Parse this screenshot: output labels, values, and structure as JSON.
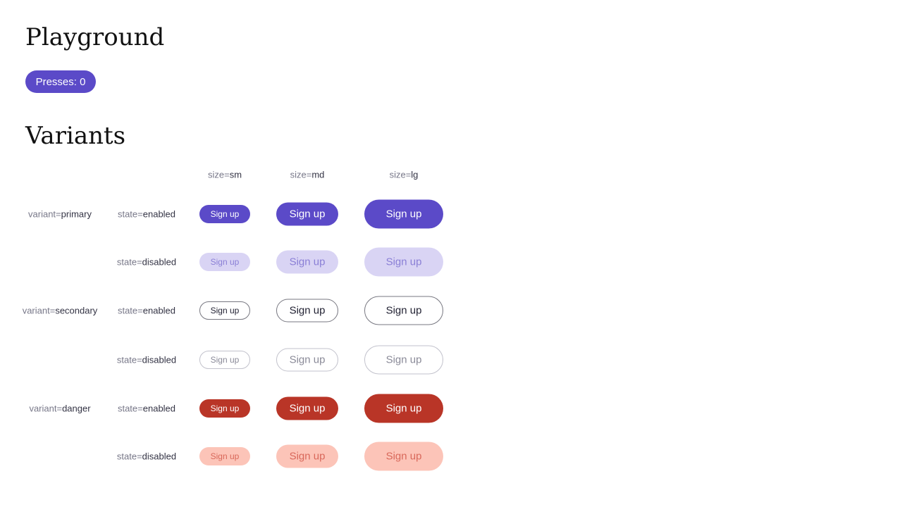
{
  "playground": {
    "title": "Playground",
    "presses_label": "Presses: 0"
  },
  "variants_section": {
    "title": "Variants",
    "sizes": [
      {
        "key": "size=",
        "value": "sm"
      },
      {
        "key": "size=",
        "value": "md"
      },
      {
        "key": "size=",
        "value": "lg"
      }
    ],
    "rows": [
      {
        "variant_key": "variant=",
        "variant_value": "primary",
        "state_key": "state=",
        "state_value": "enabled",
        "button_label": "Sign up"
      },
      {
        "variant_key": "",
        "variant_value": "",
        "state_key": "state=",
        "state_value": "disabled",
        "button_label": "Sign up"
      },
      {
        "variant_key": "variant=",
        "variant_value": "secondary",
        "state_key": "state=",
        "state_value": "enabled",
        "button_label": "Sign up"
      },
      {
        "variant_key": "",
        "variant_value": "",
        "state_key": "state=",
        "state_value": "disabled",
        "button_label": "Sign up"
      },
      {
        "variant_key": "variant=",
        "variant_value": "danger",
        "state_key": "state=",
        "state_value": "enabled",
        "button_label": "Sign up"
      },
      {
        "variant_key": "",
        "variant_value": "",
        "state_key": "state=",
        "state_value": "disabled",
        "button_label": "Sign up"
      }
    ]
  },
  "colors": {
    "primary": "#5b4ac8",
    "primary_disabled": "#d9d4f4",
    "secondary_border": "#777780",
    "danger": "#b93527",
    "danger_disabled": "#fcc4b8"
  }
}
